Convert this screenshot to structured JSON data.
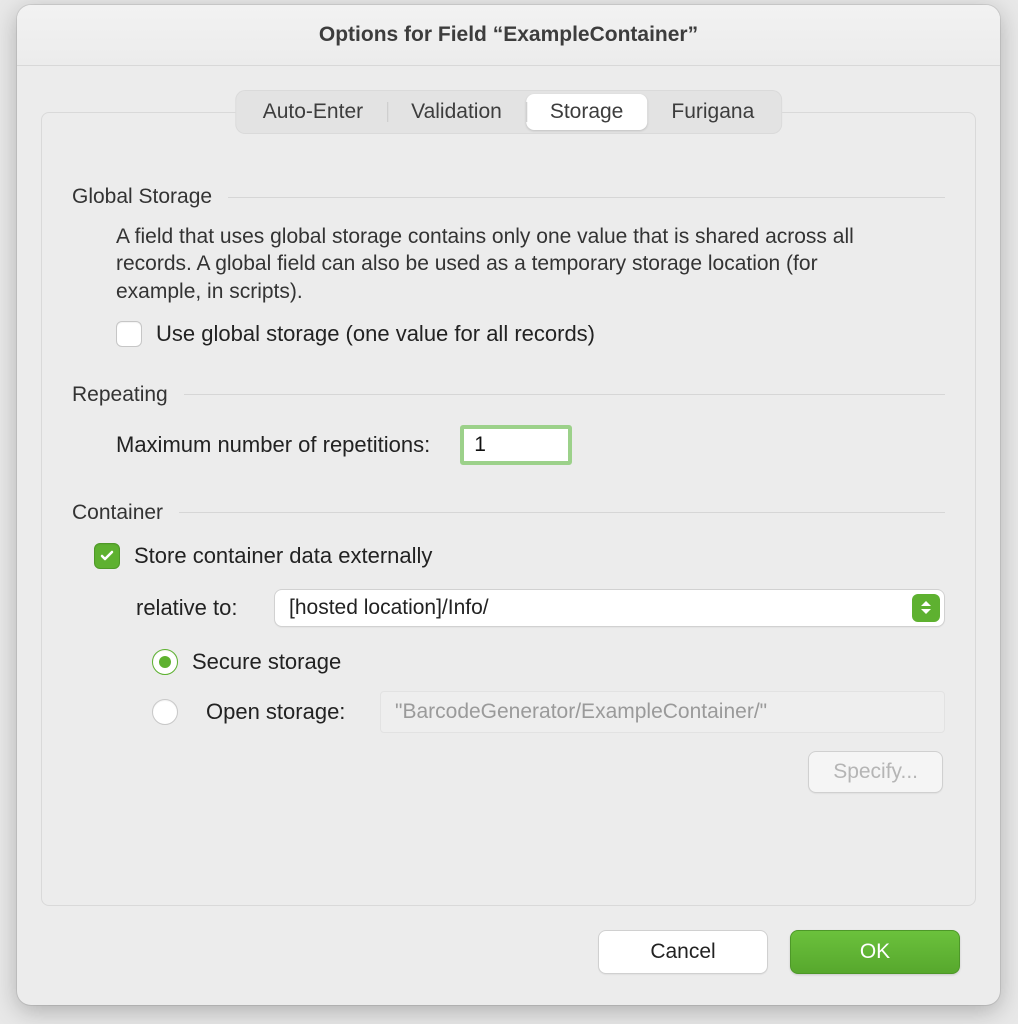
{
  "colors": {
    "accent": "#5eb130"
  },
  "window": {
    "title": "Options for Field “ExampleContainer”"
  },
  "tabs": [
    {
      "label": "Auto-Enter",
      "active": false
    },
    {
      "label": "Validation",
      "active": false
    },
    {
      "label": "Storage",
      "active": true
    },
    {
      "label": "Furigana",
      "active": false
    }
  ],
  "global_storage": {
    "heading": "Global Storage",
    "description": "A field that uses global storage contains only one value that is shared across all records.  A global field can also be used as a temporary storage location (for example, in scripts).",
    "use_global_label": "Use global storage (one value for all records)",
    "use_global_checked": false
  },
  "repeating": {
    "heading": "Repeating",
    "max_label": "Maximum number of repetitions:",
    "max_value": "1"
  },
  "container": {
    "heading": "Container",
    "store_externally_label": "Store container data externally",
    "store_externally_checked": true,
    "relative_to_label": "relative to:",
    "relative_to_value": "[hosted location]/Info/",
    "secure_label": "Secure storage",
    "secure_selected": true,
    "open_label": "Open storage:",
    "open_selected": false,
    "open_path_value": "\"BarcodeGenerator/ExampleContainer/\"",
    "specify_label": "Specify...",
    "specify_enabled": false
  },
  "footer": {
    "cancel": "Cancel",
    "ok": "OK"
  }
}
